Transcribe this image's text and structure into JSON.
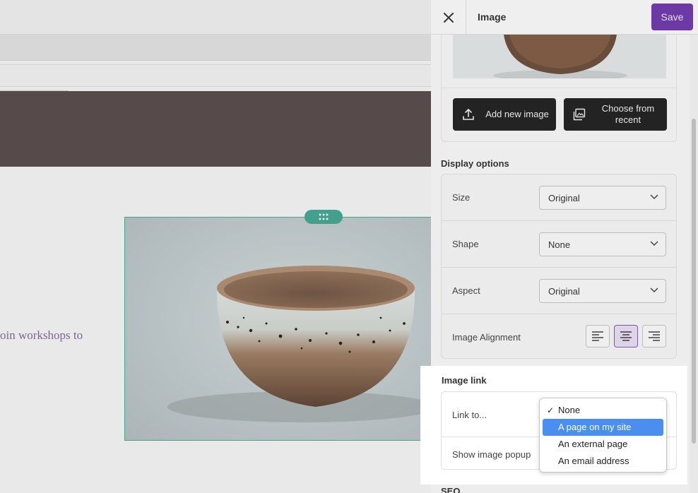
{
  "panel": {
    "title": "Image",
    "save_label": "Save"
  },
  "canvas": {
    "body_text": "oin workshops to"
  },
  "image_buttons": {
    "add_new": "Add new image",
    "choose_recent": "Choose from recent"
  },
  "display_options": {
    "section_label": "Display options",
    "size_label": "Size",
    "size_value": "Original",
    "shape_label": "Shape",
    "shape_value": "None",
    "aspect_label": "Aspect",
    "aspect_value": "Original",
    "alignment_label": "Image Alignment",
    "alignment_selected": "center"
  },
  "image_link": {
    "section_label": "Image link",
    "link_to_label": "Link to...",
    "popup_label": "Show image popup",
    "dropdown": {
      "options": [
        "None",
        "A page on my site",
        "An external page",
        "An email address"
      ],
      "checked": "None",
      "highlighted": "A page on my site"
    }
  },
  "seo": {
    "section_label": "SEO"
  },
  "colors": {
    "accent": "#6b3aa6",
    "handle": "#43a08c",
    "highlight": "#4a8ff0"
  }
}
